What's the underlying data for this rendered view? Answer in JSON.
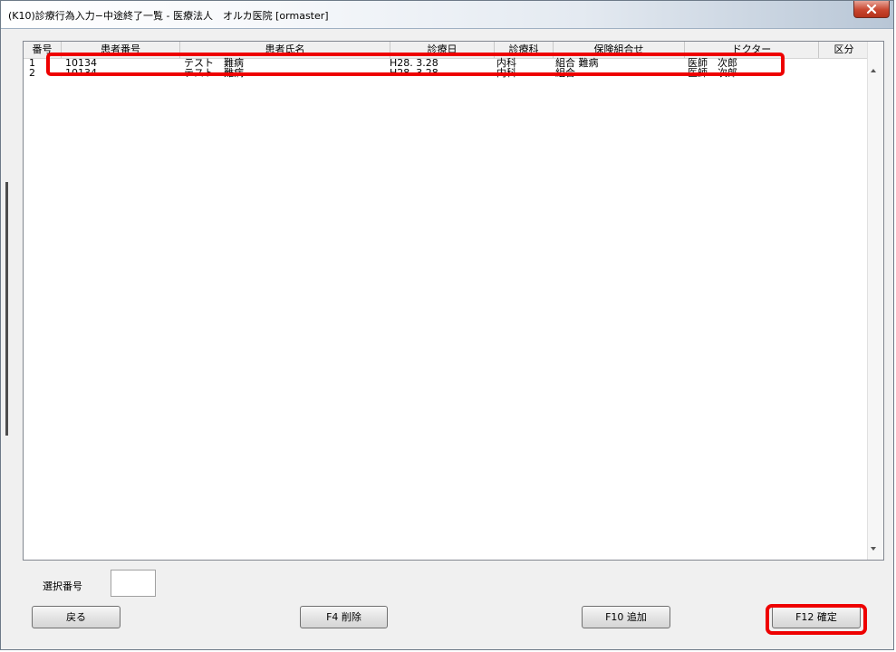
{
  "window": {
    "title": "(K10)診療行為入力−中途終了一覧 - 医療法人　オルカ医院 [ormaster]"
  },
  "table": {
    "columns": [
      "番号",
      "患者番号",
      "患者氏名",
      "診療日",
      "診療科",
      "保険組合せ",
      "ドクター",
      "区分"
    ],
    "rows": [
      [
        "1",
        "10134",
        "テスト　難病",
        "H28. 3.28",
        "内科",
        "組合 難病",
        "医師　次郎",
        ""
      ],
      [
        "2",
        "10134",
        "テスト　難病",
        "H28. 3.28",
        "内科",
        "組合",
        "医師　次郎",
        ""
      ]
    ]
  },
  "footer": {
    "select_label": "選択番号",
    "select_value": ""
  },
  "buttons": {
    "back": "戻る",
    "delete": "F4 削除",
    "add": "F10 追加",
    "confirm": "F12 確定"
  },
  "colors": {
    "highlight": "#ee0000",
    "close_button": "#c9462f"
  },
  "icons": {
    "close": "close-icon",
    "scroll_up": "scroll-up-icon",
    "scroll_down": "scroll-down-icon"
  }
}
